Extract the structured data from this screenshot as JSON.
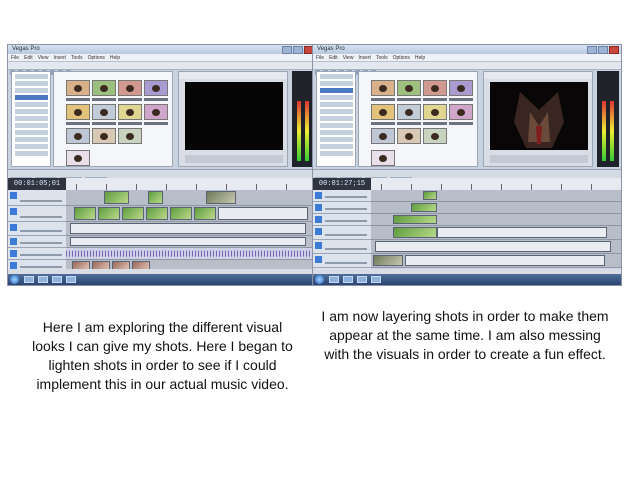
{
  "screenshots": [
    {
      "window_title": "Vegas Pro",
      "menu": [
        "File",
        "Edit",
        "View",
        "Insert",
        "Tools",
        "Options",
        "Help"
      ],
      "timecode": "00:01:05;01",
      "clock_time": "",
      "clock_date": ""
    },
    {
      "window_title": "Vegas Pro",
      "menu": [
        "File",
        "Edit",
        "View",
        "Insert",
        "Tools",
        "Options",
        "Help"
      ],
      "timecode": "00:01:27;15",
      "clock_time": "",
      "clock_date": ""
    }
  ],
  "captions": {
    "left": "Here I am exploring the different visual looks I can give my shots. Here I began to lighten shots in order to see if I could implement this in our actual music video.",
    "right": "I am now layering shots in order to make them appear at the same time. I am also messing with the visuals  in order to create a fun effect."
  },
  "colors": {
    "timeline_audio_wave": "#6a4fa7",
    "track_header": "#dde3ec",
    "taskbar": "#2b4570"
  },
  "icons": [
    "windows-start-icon",
    "minimize-icon",
    "maximize-icon",
    "close-icon"
  ]
}
